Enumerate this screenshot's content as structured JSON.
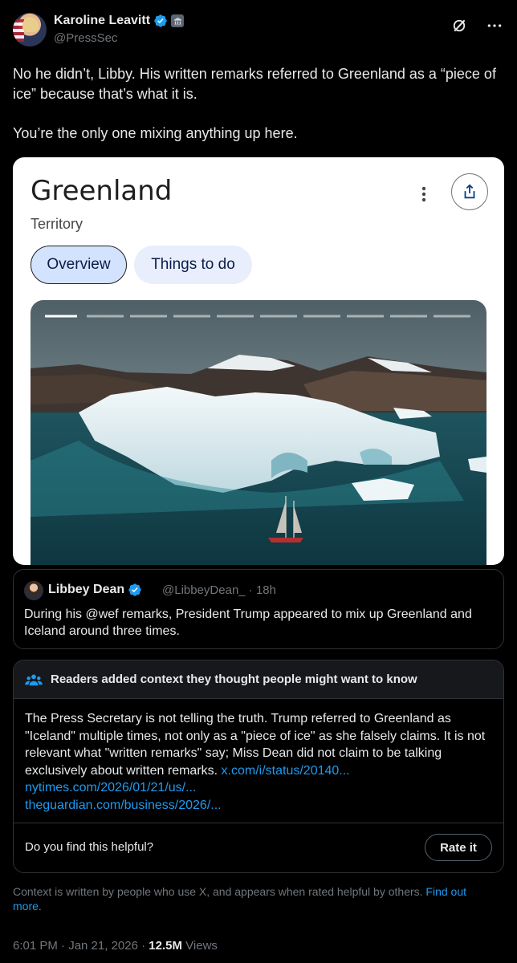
{
  "post": {
    "author_name": "Karoline Leavitt",
    "author_handle": "@PressSec",
    "text_line1": "No he didn’t, Libby. His written remarks referred to Greenland as a “piece of ice” because that’s what it is.",
    "text_line2": "You’re the only one mixing anything up here.",
    "time": "6:01 PM · Jan 21, 2026 ·",
    "views_count": "12.5M",
    "views_label": "Views"
  },
  "card": {
    "title": "Greenland",
    "subtitle": "Territory",
    "chip_overview": "Overview",
    "chip_things": "Things to do"
  },
  "quote": {
    "name": "Libbey Dean",
    "handle": "@LibbeyDean_ · 18h",
    "text": "During his @wef remarks, President Trump appeared to mix up Greenland and Iceland around three times."
  },
  "notes": {
    "header": "Readers added context they thought people might want to know",
    "body": "The Press Secretary is not telling the truth. Trump referred to Greenland as \"Iceland\" multiple times, not only as a \"piece of ice\" as she falsely claims. It is not relevant what \"written remarks\" say; Miss Dean did not claim to be talking exclusively about written remarks.",
    "link1": "x.com/i/status/20140...",
    "link2": "nytimes.com/2026/01/21/us/...",
    "link3": "theguardian.com/business/2026/...",
    "helpful_q": "Do you find this helpful?",
    "rate_label": "Rate it"
  },
  "footnote": {
    "text": "Context is written by people who use X, and appears when rated helpful by others.",
    "link": "Find out more."
  },
  "colors": {
    "accent": "#1d9bf0",
    "verified": "#1d9bf0",
    "muted": "#71767b"
  },
  "icons": [
    "verified-icon",
    "government-badge-icon",
    "grok-icon",
    "more-icon",
    "share-icon",
    "community-notes-icon"
  ]
}
